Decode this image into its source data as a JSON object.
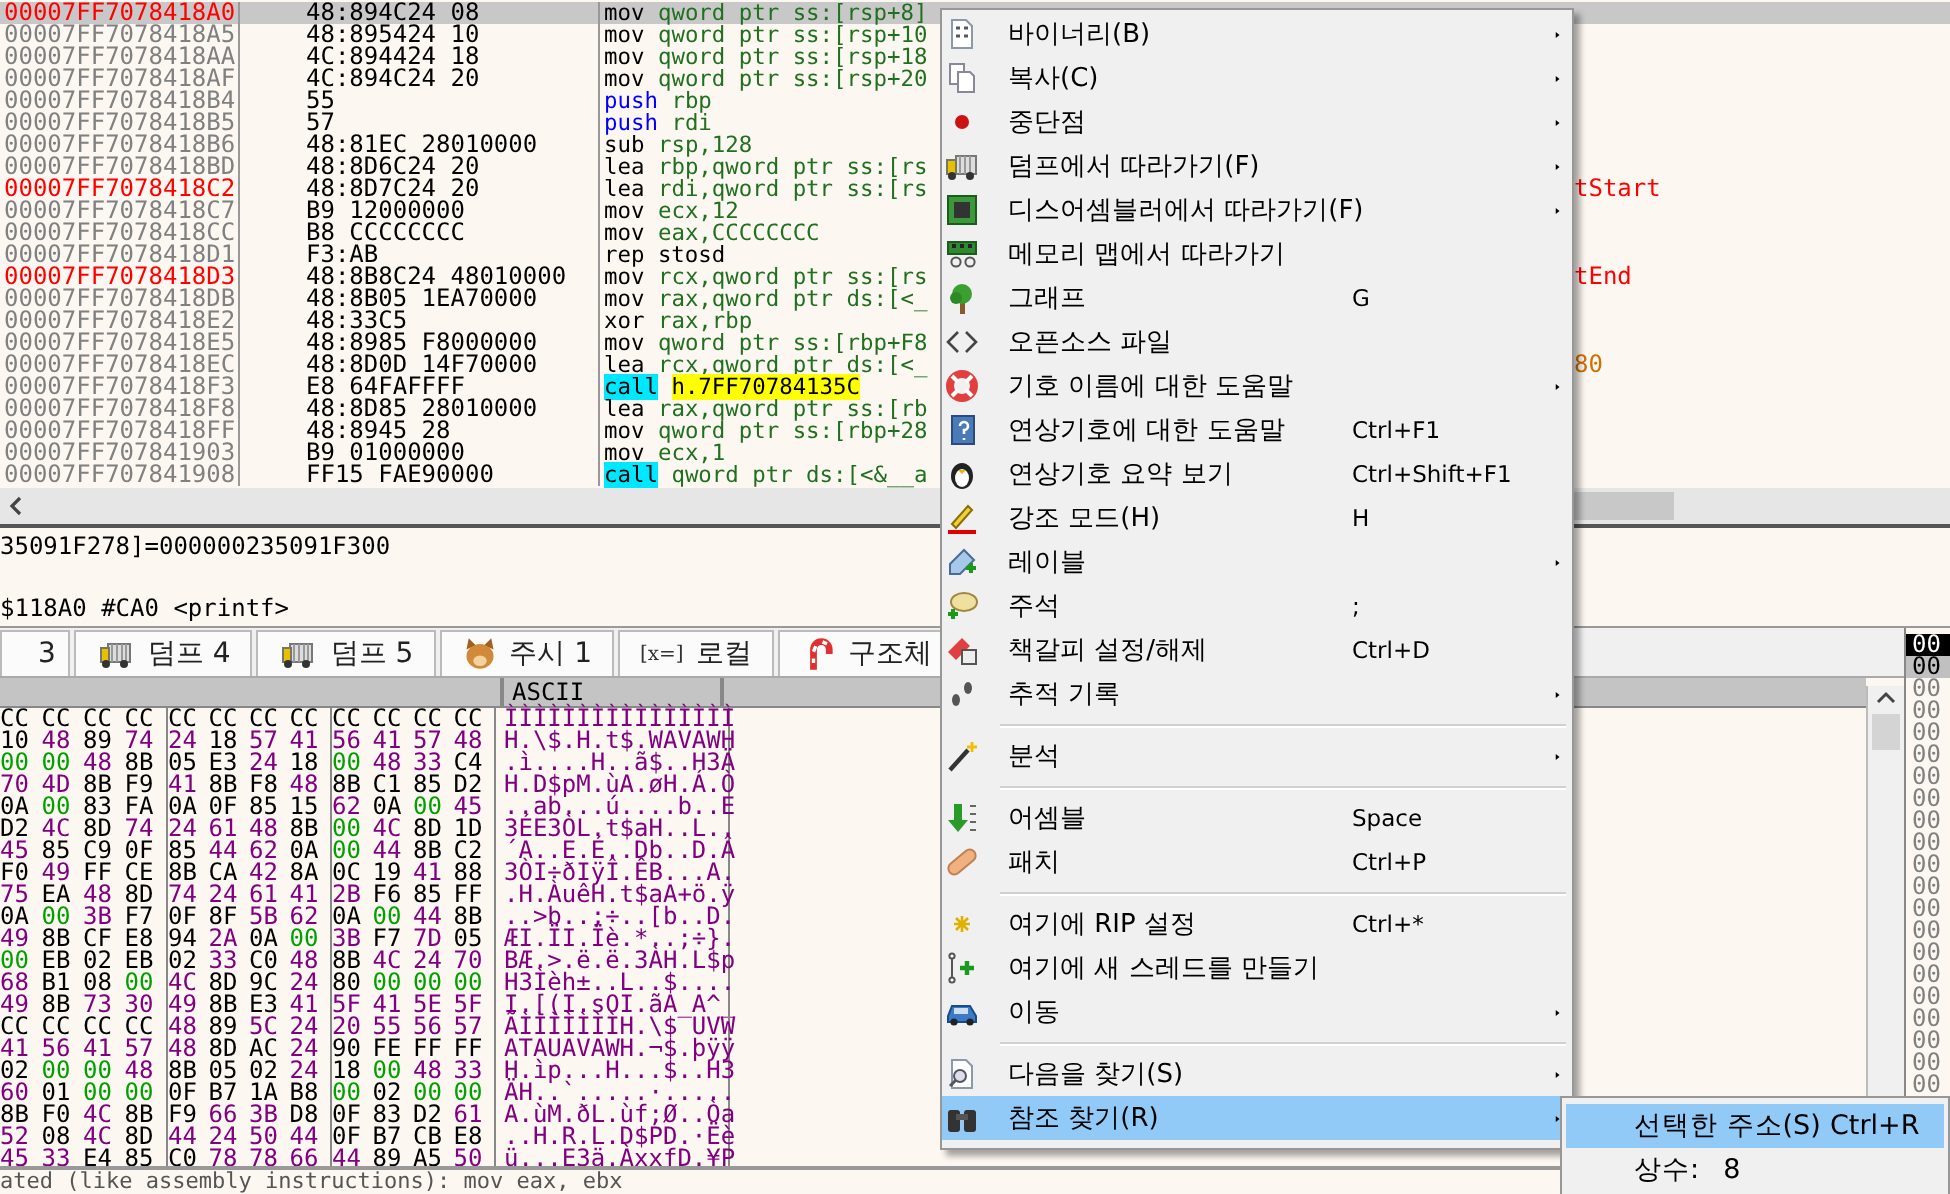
{
  "disassembly": {
    "rows": [
      {
        "address": "00007FF7078418A0",
        "bytes": "48:894C24 08",
        "kind": "mov",
        "mnemonic": "mov",
        "operands": "qword ptr ss:[rsp+8]",
        "breakpoint": true,
        "selected": true
      },
      {
        "address": "00007FF7078418A5",
        "bytes": "48:895424 10",
        "kind": "mov",
        "mnemonic": "mov",
        "operands": "qword ptr ss:[rsp+10",
        "breakpoint": false,
        "selected": false
      },
      {
        "address": "00007FF7078418AA",
        "bytes": "4C:894424 18",
        "kind": "mov",
        "mnemonic": "mov",
        "operands": "qword ptr ss:[rsp+18",
        "breakpoint": false,
        "selected": false
      },
      {
        "address": "00007FF7078418AF",
        "bytes": "4C:894C24 20",
        "kind": "mov",
        "mnemonic": "mov",
        "operands": "qword ptr ss:[rsp+20",
        "breakpoint": false,
        "selected": false
      },
      {
        "address": "00007FF7078418B4",
        "bytes": "55",
        "kind": "push",
        "mnemonic": "push",
        "operands": "rbp",
        "breakpoint": false,
        "selected": false
      },
      {
        "address": "00007FF7078418B5",
        "bytes": "57",
        "kind": "push",
        "mnemonic": "push",
        "operands": "rdi",
        "breakpoint": false,
        "selected": false
      },
      {
        "address": "00007FF7078418B6",
        "bytes": "48:81EC 28010000",
        "kind": "mov",
        "mnemonic": "sub",
        "operands": "rsp,128",
        "breakpoint": false,
        "selected": false
      },
      {
        "address": "00007FF7078418BD",
        "bytes": "48:8D6C24 20",
        "kind": "mov",
        "mnemonic": "lea",
        "operands": "rbp,qword ptr ss:[rs",
        "breakpoint": false,
        "selected": false
      },
      {
        "address": "00007FF7078418C2",
        "bytes": "48:8D7C24 20",
        "kind": "mov",
        "mnemonic": "lea",
        "operands": "rdi,qword ptr ss:[rs",
        "breakpoint": true,
        "selected": false,
        "comment": "tStart",
        "color": "#ff0000"
      },
      {
        "address": "00007FF7078418C7",
        "bytes": "B9 12000000",
        "kind": "mov",
        "mnemonic": "mov",
        "operands": "ecx,12",
        "breakpoint": false,
        "selected": false
      },
      {
        "address": "00007FF7078418CC",
        "bytes": "B8 CCCCCCCC",
        "kind": "mov",
        "mnemonic": "mov",
        "operands": "eax,CCCCCCCC",
        "breakpoint": false,
        "selected": false
      },
      {
        "address": "00007FF7078418D1",
        "bytes": "F3:AB",
        "kind": "mov",
        "mnemonic": "rep stosd",
        "breakpoint": false,
        "selected": false
      },
      {
        "address": "00007FF7078418D3",
        "bytes": "48:8B8C24 48010000",
        "kind": "mov",
        "mnemonic": "mov",
        "operands": "rcx,qword ptr ss:[rs",
        "breakpoint": true,
        "selected": false,
        "comment": "tEnd",
        "color": "#ff0000"
      },
      {
        "address": "00007FF7078418DB",
        "bytes": "48:8B05 1EA70000",
        "kind": "mov",
        "mnemonic": "mov",
        "operands": "rax,qword ptr ds:[<_",
        "breakpoint": false,
        "selected": false
      },
      {
        "address": "00007FF7078418E2",
        "bytes": "48:33C5",
        "kind": "mov",
        "mnemonic": "xor",
        "operands": "rax,rbp",
        "breakpoint": false,
        "selected": false
      },
      {
        "address": "00007FF7078418E5",
        "bytes": "48:8985 F8000000",
        "kind": "mov",
        "mnemonic": "mov",
        "operands": "qword ptr ss:[rbp+F8",
        "breakpoint": false,
        "selected": false
      },
      {
        "address": "00007FF7078418EC",
        "bytes": "48:8D0D 14F70000",
        "kind": "mov",
        "mnemonic": "lea",
        "operands": "rcx,qword ptr ds:[<_",
        "breakpoint": false,
        "selected": false,
        "comment": "80",
        "color": "#d07000"
      },
      {
        "address": "00007FF7078418F3",
        "bytes": "E8 64FAFFFF",
        "kind": "call",
        "mnemonic": "call",
        "operands": "h.7FF70784135C",
        "breakpoint": false,
        "selected": false,
        "operand_highlight": true
      },
      {
        "address": "00007FF7078418F8",
        "bytes": "48:8D85 28010000",
        "kind": "mov",
        "mnemonic": "lea",
        "operands": "rax,qword ptr ss:[rb",
        "breakpoint": false,
        "selected": false
      },
      {
        "address": "00007FF7078418FF",
        "bytes": "48:8945 28",
        "kind": "mov",
        "mnemonic": "mov",
        "operands": "qword ptr ss:[rbp+28",
        "breakpoint": false,
        "selected": false
      },
      {
        "address": "00007FF707841903",
        "bytes": "B9 01000000",
        "kind": "mov",
        "mnemonic": "mov",
        "operands": "ecx,1",
        "breakpoint": false,
        "selected": false
      },
      {
        "address": "00007FF707841908",
        "bytes": "FF15 FAE90000",
        "kind": "call",
        "mnemonic": "call",
        "operands": "qword ptr ds:[<&__a",
        "breakpoint": false,
        "selected": false
      }
    ]
  },
  "info": {
    "lines": [
      "35091F278]=000000235091F300",
      "$118A0 #CA0 <printf>"
    ]
  },
  "tabs": [
    {
      "label": "3",
      "selected": false
    },
    {
      "label": "덤프 4",
      "selected": false
    },
    {
      "label": "덤프 5",
      "selected": false
    },
    {
      "label": "주시 1",
      "selected": false
    },
    {
      "label": "로컬",
      "badge": "[x=]",
      "selected": false
    },
    {
      "label": "구조체",
      "selected": false
    }
  ],
  "dump": {
    "header": "ASCII",
    "rows": [
      {
        "bytes": [
          "CC",
          "CC",
          "CC",
          "CC",
          "CC",
          "CC",
          "CC",
          "CC",
          "CC",
          "CC",
          "CC",
          "CC"
        ],
        "ascii": "ÌÌÌÌÌÌÌÌÌÌÌÌÌÌÌÌ"
      },
      {
        "bytes": [
          "10",
          "48",
          "89",
          "74",
          "24",
          "18",
          "57",
          "41",
          "56",
          "41",
          "57",
          "48"
        ],
        "ascii": "H.\\$.H.t$.WAVAWH"
      },
      {
        "bytes": [
          "00",
          "00",
          "48",
          "8B",
          "05",
          "E3",
          "24",
          "18",
          "00",
          "48",
          "33",
          "C4"
        ],
        "ascii": ".ì....H..ã$..H3Ä"
      },
      {
        "bytes": [
          "70",
          "4D",
          "8B",
          "F9",
          "41",
          "8B",
          "F8",
          "48",
          "8B",
          "C1",
          "85",
          "D2"
        ],
        "ascii": "H.D$pM.ùA.øH.Á.Ò"
      },
      {
        "bytes": [
          "0A",
          "00",
          "83",
          "FA",
          "0A",
          "0F",
          "85",
          "15",
          "62",
          "0A",
          "00",
          "45"
        ],
        "ascii": "..ab...ú....b..E"
      },
      {
        "bytes": [
          "D2",
          "4C",
          "8D",
          "74",
          "24",
          "61",
          "48",
          "8B",
          "00",
          "4C",
          "8D",
          "1D"
        ],
        "ascii": "3ÉE3ÒL.t$aH..L.."
      },
      {
        "bytes": [
          "45",
          "85",
          "C9",
          "0F",
          "85",
          "44",
          "62",
          "0A",
          "00",
          "44",
          "8B",
          "C2"
        ],
        "ascii": "´A..E.É..Db..D.Â"
      },
      {
        "bytes": [
          "F0",
          "49",
          "FF",
          "CE",
          "8B",
          "CA",
          "42",
          "8A",
          "0C",
          "19",
          "41",
          "88"
        ],
        "ascii": "3ÒI÷ðIÿÎ.ÊB...A."
      },
      {
        "bytes": [
          "75",
          "EA",
          "48",
          "8D",
          "74",
          "24",
          "61",
          "41",
          "2B",
          "F6",
          "85",
          "FF"
        ],
        "ascii": ".H.ÀuêH.t$aA+ö.ÿ"
      },
      {
        "bytes": [
          "0A",
          "00",
          "3B",
          "F7",
          "0F",
          "8F",
          "5B",
          "62",
          "0A",
          "00",
          "44",
          "8B"
        ],
        "ascii": "..>b..;÷..[b..D."
      },
      {
        "bytes": [
          "49",
          "8B",
          "CF",
          "E8",
          "94",
          "2A",
          "0A",
          "00",
          "3B",
          "F7",
          "7D",
          "05"
        ],
        "ascii": "ÆI.ÏI.Ïè.*..;÷}."
      },
      {
        "bytes": [
          "00",
          "EB",
          "02",
          "EB",
          "02",
          "33",
          "C0",
          "48",
          "8B",
          "4C",
          "24",
          "70"
        ],
        "ascii": "BÆ.>.ë.ë.3ÀH.L$p"
      },
      {
        "bytes": [
          "68",
          "B1",
          "08",
          "00",
          "4C",
          "8D",
          "9C",
          "24",
          "80",
          "00",
          "00",
          "00"
        ],
        "ascii": "H3Ìèh±..L..$...."
      },
      {
        "bytes": [
          "49",
          "8B",
          "73",
          "30",
          "49",
          "8B",
          "E3",
          "41",
          "5F",
          "41",
          "5E",
          "5F"
        ],
        "ascii": "I.[(I.sOI.ãA_A^_"
      },
      {
        "bytes": [
          "CC",
          "CC",
          "CC",
          "CC",
          "48",
          "89",
          "5C",
          "24",
          "20",
          "55",
          "56",
          "57"
        ],
        "ascii": "ÃÌÌÌÌÌÌÌH.\\$ UVW"
      },
      {
        "bytes": [
          "41",
          "56",
          "41",
          "57",
          "48",
          "8D",
          "AC",
          "24",
          "90",
          "FE",
          "FF",
          "FF"
        ],
        "ascii": "ATAUAVAWH.¬$.þÿÿ"
      },
      {
        "bytes": [
          "02",
          "00",
          "00",
          "48",
          "8B",
          "05",
          "02",
          "24",
          "18",
          "00",
          "48",
          "33"
        ],
        "ascii": "H.ìp...H...$..H3"
      },
      {
        "bytes": [
          "60",
          "01",
          "00",
          "00",
          "0F",
          "B7",
          "1A",
          "B8",
          "00",
          "02",
          "00",
          "00"
        ],
        "ascii": "ÄH..`.....·....."
      },
      {
        "bytes": [
          "8B",
          "F0",
          "4C",
          "8B",
          "F9",
          "66",
          "3B",
          "D8",
          "0F",
          "83",
          "D2",
          "61"
        ],
        "ascii": "A.ùM.ðL.ùf;Ø..Òa"
      },
      {
        "bytes": [
          "52",
          "08",
          "4C",
          "8D",
          "44",
          "24",
          "50",
          "44",
          "0F",
          "B7",
          "CB",
          "E8"
        ],
        "ascii": "..H.R.L.D$PD.·Ëè"
      },
      {
        "bytes": [
          "45",
          "33",
          "E4",
          "85",
          "C0",
          "78",
          "78",
          "66",
          "44",
          "89",
          "A5",
          "50"
        ],
        "ascii": "ü...E3ä.ÀxxfD.¥P"
      }
    ]
  },
  "stack": [
    {
      "text": "00",
      "selected": true,
      "current": false
    },
    {
      "text": "00",
      "selected": false,
      "current": true
    },
    {
      "text": "00",
      "selected": false,
      "current": false
    },
    {
      "text": "00",
      "selected": false,
      "current": false
    },
    {
      "text": "00",
      "selected": false,
      "current": false
    },
    {
      "text": "00",
      "selected": false,
      "current": false
    },
    {
      "text": "00",
      "selected": false,
      "current": false
    },
    {
      "text": "00",
      "selected": false,
      "current": false
    },
    {
      "text": "00",
      "selected": false,
      "current": false
    },
    {
      "text": "00",
      "selected": false,
      "current": false
    },
    {
      "text": "00",
      "selected": false,
      "current": false
    },
    {
      "text": "00",
      "selected": false,
      "current": false
    },
    {
      "text": "00",
      "selected": false,
      "current": false
    },
    {
      "text": "00",
      "selected": false,
      "current": false
    },
    {
      "text": "00",
      "selected": false,
      "current": false
    },
    {
      "text": "00",
      "selected": false,
      "current": false
    },
    {
      "text": "00",
      "selected": false,
      "current": false
    },
    {
      "text": "00",
      "selected": false,
      "current": false
    },
    {
      "text": "00",
      "selected": false,
      "current": false
    },
    {
      "text": "00",
      "selected": false,
      "current": false
    },
    {
      "text": "00",
      "selected": false,
      "current": false
    }
  ],
  "log_line": "ated (like assembly instructions): mov eax, ebx",
  "context_menu": {
    "items": [
      {
        "kind": "item",
        "label": "바이너리(B)",
        "submenu": true,
        "selected": false
      },
      {
        "kind": "item",
        "label": "복사(C)",
        "submenu": true,
        "selected": false
      },
      {
        "kind": "item",
        "label": "중단점",
        "submenu": true,
        "selected": false
      },
      {
        "kind": "item",
        "label": "덤프에서 따라가기(F)",
        "submenu": true,
        "selected": false
      },
      {
        "kind": "item",
        "label": "디스어셈블러에서 따라가기(F)",
        "submenu": true,
        "selected": false
      },
      {
        "kind": "item",
        "label": "메모리 맵에서 따라가기",
        "submenu": false,
        "selected": false
      },
      {
        "kind": "item",
        "label": "그래프",
        "shortcut": "G",
        "submenu": false,
        "selected": false
      },
      {
        "kind": "item",
        "label": "오픈소스 파일",
        "submenu": false,
        "selected": false
      },
      {
        "kind": "item",
        "label": "기호 이름에 대한 도움말",
        "submenu": true,
        "selected": false
      },
      {
        "kind": "item",
        "label": "연상기호에 대한 도움말",
        "shortcut": "Ctrl+F1",
        "submenu": false,
        "selected": false
      },
      {
        "kind": "item",
        "label": "연상기호 요약 보기",
        "shortcut": "Ctrl+Shift+F1",
        "submenu": false,
        "selected": false
      },
      {
        "kind": "item",
        "label": "강조 모드(H)",
        "shortcut": "H",
        "submenu": false,
        "selected": false
      },
      {
        "kind": "item",
        "label": "레이블",
        "submenu": true,
        "selected": false
      },
      {
        "kind": "item",
        "label": "주석",
        "shortcut": ";",
        "submenu": false,
        "selected": false
      },
      {
        "kind": "item",
        "label": "책갈피 설정/해제",
        "shortcut": "Ctrl+D",
        "submenu": false,
        "selected": false
      },
      {
        "kind": "item",
        "label": "추적 기록",
        "submenu": true,
        "selected": false
      },
      {
        "kind": "separator"
      },
      {
        "kind": "item",
        "label": "분석",
        "submenu": true,
        "selected": false
      },
      {
        "kind": "separator"
      },
      {
        "kind": "item",
        "label": "어셈블",
        "shortcut": "Space",
        "submenu": false,
        "selected": false
      },
      {
        "kind": "item",
        "label": "패치",
        "shortcut": "Ctrl+P",
        "submenu": false,
        "selected": false
      },
      {
        "kind": "separator"
      },
      {
        "kind": "item",
        "label": "여기에 RIP 설정",
        "shortcut": "Ctrl+*",
        "submenu": false,
        "selected": false
      },
      {
        "kind": "item",
        "label": "여기에 새 스레드를 만들기",
        "submenu": false,
        "selected": false
      },
      {
        "kind": "item",
        "label": "이동",
        "submenu": true,
        "selected": false
      },
      {
        "kind": "separator"
      },
      {
        "kind": "item",
        "label": "다음을 찾기(S)",
        "submenu": true,
        "selected": false
      },
      {
        "kind": "item",
        "label": "참조 찾기(R)",
        "submenu": true,
        "selected": true
      }
    ]
  },
  "submenu": {
    "items": [
      {
        "label": "선택한 주소(S)",
        "shortcut": "Ctrl+R",
        "selected": true
      },
      {
        "label": "상수:",
        "value": "8",
        "selected": false
      }
    ]
  }
}
